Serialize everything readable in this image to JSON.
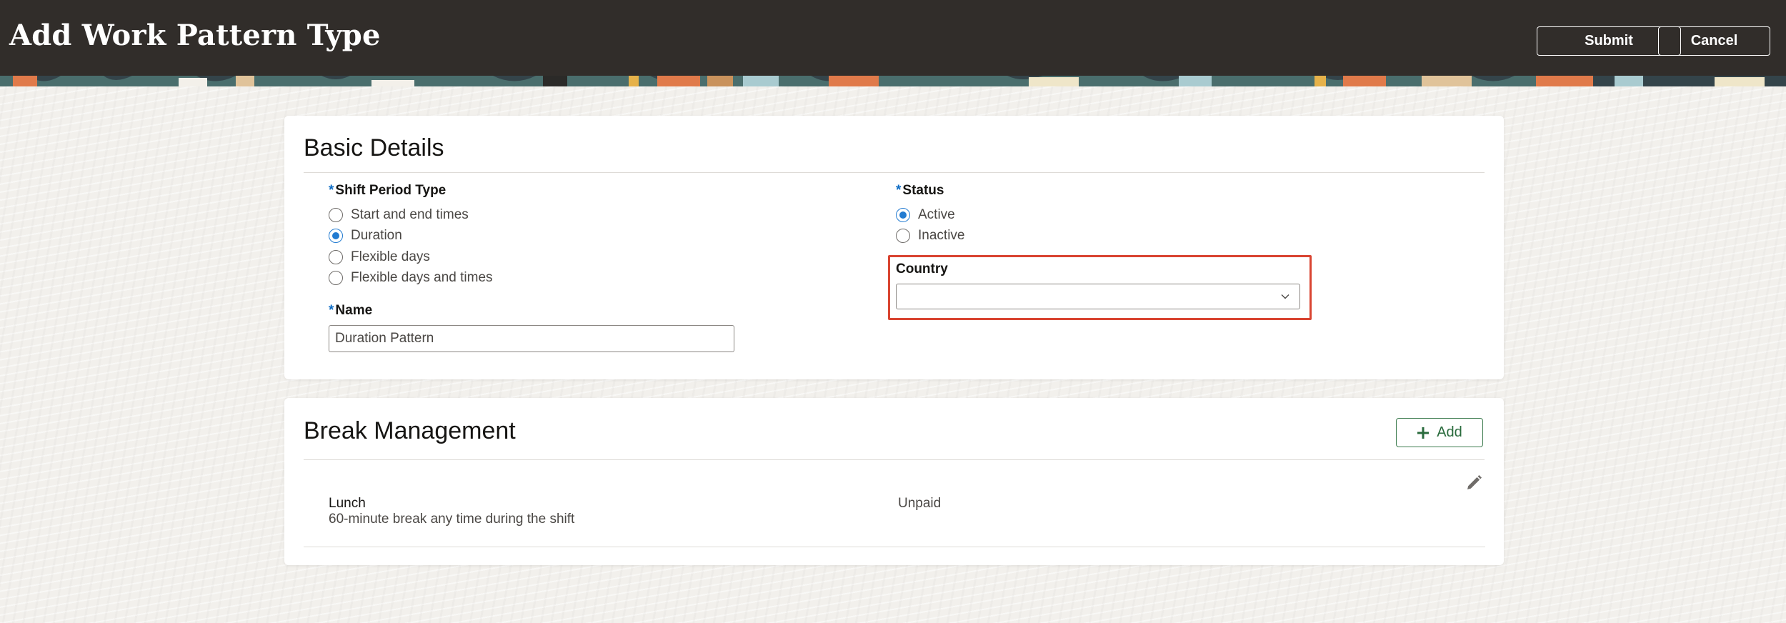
{
  "header": {
    "title": "Add Work Pattern Type",
    "submit_label": "Submit",
    "cancel_label": "Cancel"
  },
  "basic_details": {
    "title": "Basic Details",
    "shift_period_type": {
      "label": "Shift Period Type",
      "required_marker": "*",
      "options": [
        "Start and end times",
        "Duration",
        "Flexible days",
        "Flexible days and times"
      ],
      "selected": "Duration"
    },
    "name": {
      "label": "Name",
      "required_marker": "*",
      "value": "Duration Pattern"
    },
    "status": {
      "label": "Status",
      "required_marker": "*",
      "options": [
        "Active",
        "Inactive"
      ],
      "selected": "Active"
    },
    "country": {
      "label": "Country",
      "value": "",
      "icon": "chevron-down-icon"
    }
  },
  "break_management": {
    "title": "Break Management",
    "add_label": "Add",
    "add_icon": "plus-icon",
    "rows": [
      {
        "name": "Lunch",
        "description": "60-minute break any time during the shift",
        "type": "Unpaid",
        "edit_icon": "pencil-icon"
      }
    ]
  },
  "colors": {
    "header_bg": "#312d2a",
    "accent_blue": "#227bd1",
    "add_button_green": "#2a6b3d",
    "highlight_red": "#d94431"
  }
}
